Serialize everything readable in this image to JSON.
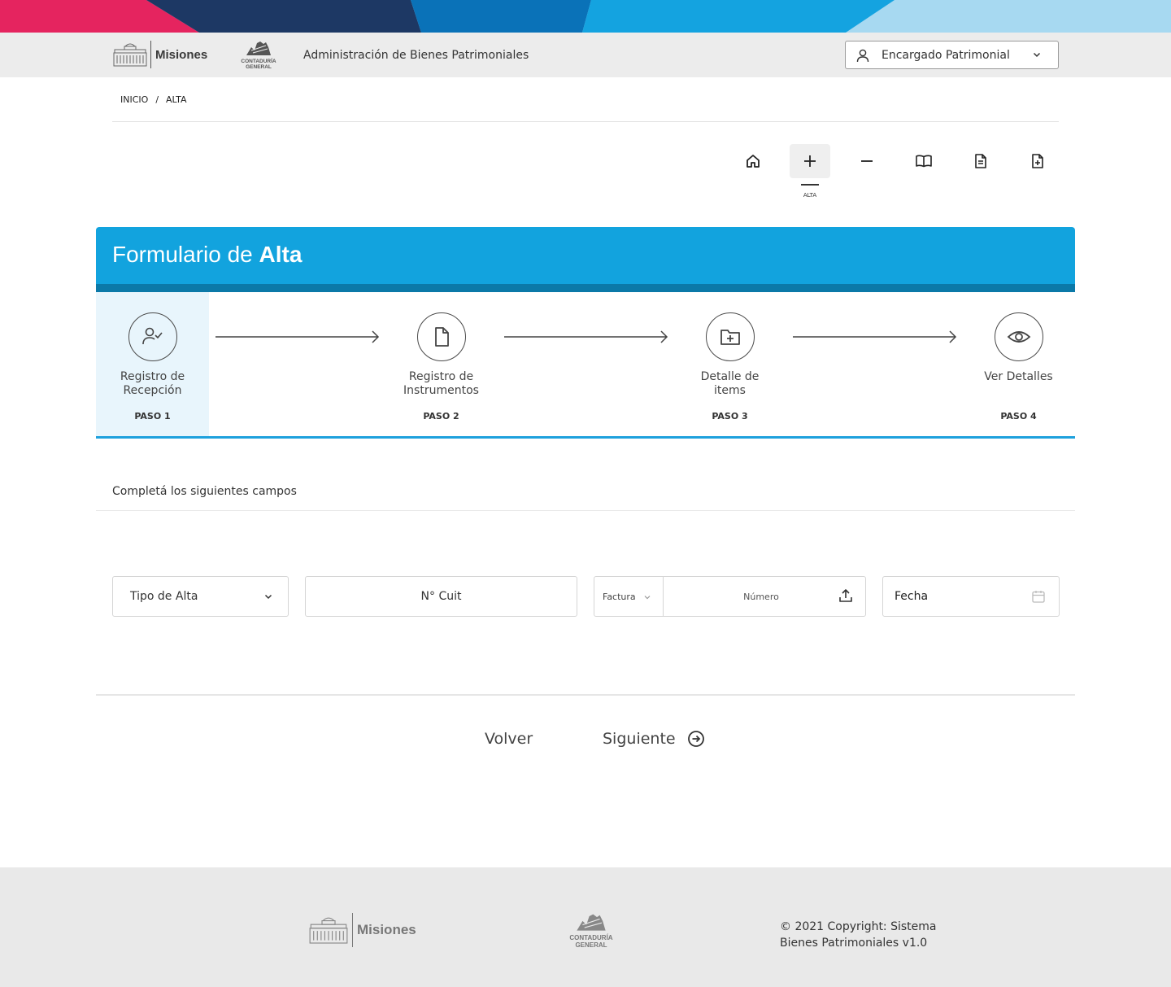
{
  "header": {
    "brand_name": "Misiones",
    "agency_line1": "CONTADURÍA",
    "agency_line2": "GENERAL",
    "title": "Administración de Bienes Patrimoniales",
    "user_role": "Encargado Patrimonial"
  },
  "breadcrumb": {
    "home": "INICIO",
    "separator": "/",
    "current": "ALTA"
  },
  "toolbar": {
    "items": [
      {
        "name": "home",
        "icon": "home-icon"
      },
      {
        "name": "alta",
        "icon": "plus-icon",
        "label": "ALTA",
        "active": true
      },
      {
        "name": "baja",
        "icon": "minus-icon"
      },
      {
        "name": "catalogo",
        "icon": "book-icon"
      },
      {
        "name": "documentos",
        "icon": "document-icon"
      },
      {
        "name": "nuevo-documento",
        "icon": "file-plus-icon"
      }
    ]
  },
  "form": {
    "title_prefix": "Formulario de",
    "title_bold": "Alta",
    "steps": [
      {
        "label_line1": "Registro de",
        "label_line2": "Recepción",
        "number": "PASO 1",
        "icon": "user-check-icon",
        "active": true
      },
      {
        "label_line1": "Registro de",
        "label_line2": "Instrumentos",
        "number": "PASO 2",
        "icon": "file-icon",
        "active": false
      },
      {
        "label_line1": "Detalle de",
        "label_line2": "items",
        "number": "PASO 3",
        "icon": "folder-plus-icon",
        "active": false
      },
      {
        "label_line1": "Ver Detalles",
        "label_line2": "",
        "number": "PASO 4",
        "icon": "eye-icon",
        "active": false
      }
    ],
    "section_title": "Completá los siguientes campos",
    "fields": {
      "tipo_alta": "Tipo de Alta",
      "cuit": "N° Cuit",
      "comprobante_tipo": "Factura",
      "comprobante_numero": "Número",
      "fecha": "Fecha"
    },
    "actions": {
      "back": "Volver",
      "next": "Siguiente"
    }
  },
  "footer": {
    "brand_name": "Misiones",
    "agency_line1": "CONTADURÍA",
    "agency_line2": "GENERAL",
    "copyright_line1": "© 2021 Copyright: Sistema",
    "copyright_line2": "Bienes Patrimoniales v1.0"
  },
  "colors": {
    "primary": "#12a3de",
    "primary_dark": "#0b79a8",
    "band_pink": "#e5245f",
    "band_navy": "#1d3864",
    "band_blue": "#0a72b8",
    "band_light": "#a7d9f1",
    "step_active_bg": "#e8f5fc"
  }
}
